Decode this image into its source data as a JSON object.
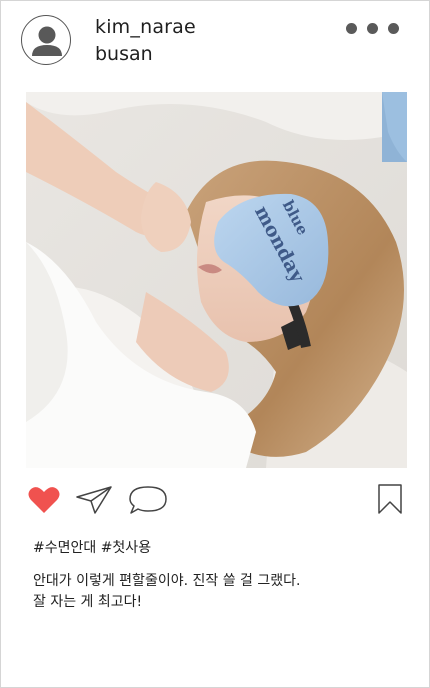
{
  "post": {
    "username": "kim_narae",
    "location": "busan",
    "photo_text": {
      "line1": "blue",
      "line2": "monday"
    },
    "hashtags": "#수면안대 #첫사용",
    "caption": {
      "line1": "안대가 이렇게 편할줄이야. 진작 쓸 걸 그랬다.",
      "line2": "잘 자는 게 최고다!"
    }
  },
  "icons": {
    "avatar": "user-avatar-icon",
    "more": "more-horizontal-icon",
    "like": "heart-icon",
    "share": "paper-plane-icon",
    "comment": "speech-bubble-icon",
    "save": "bookmark-icon"
  },
  "colors": {
    "like_active": "#f0524f",
    "icon_outline": "#444444",
    "mask_blue": "#aac8e6",
    "mask_text": "#3f5a88",
    "border": "#d5d5d5"
  }
}
